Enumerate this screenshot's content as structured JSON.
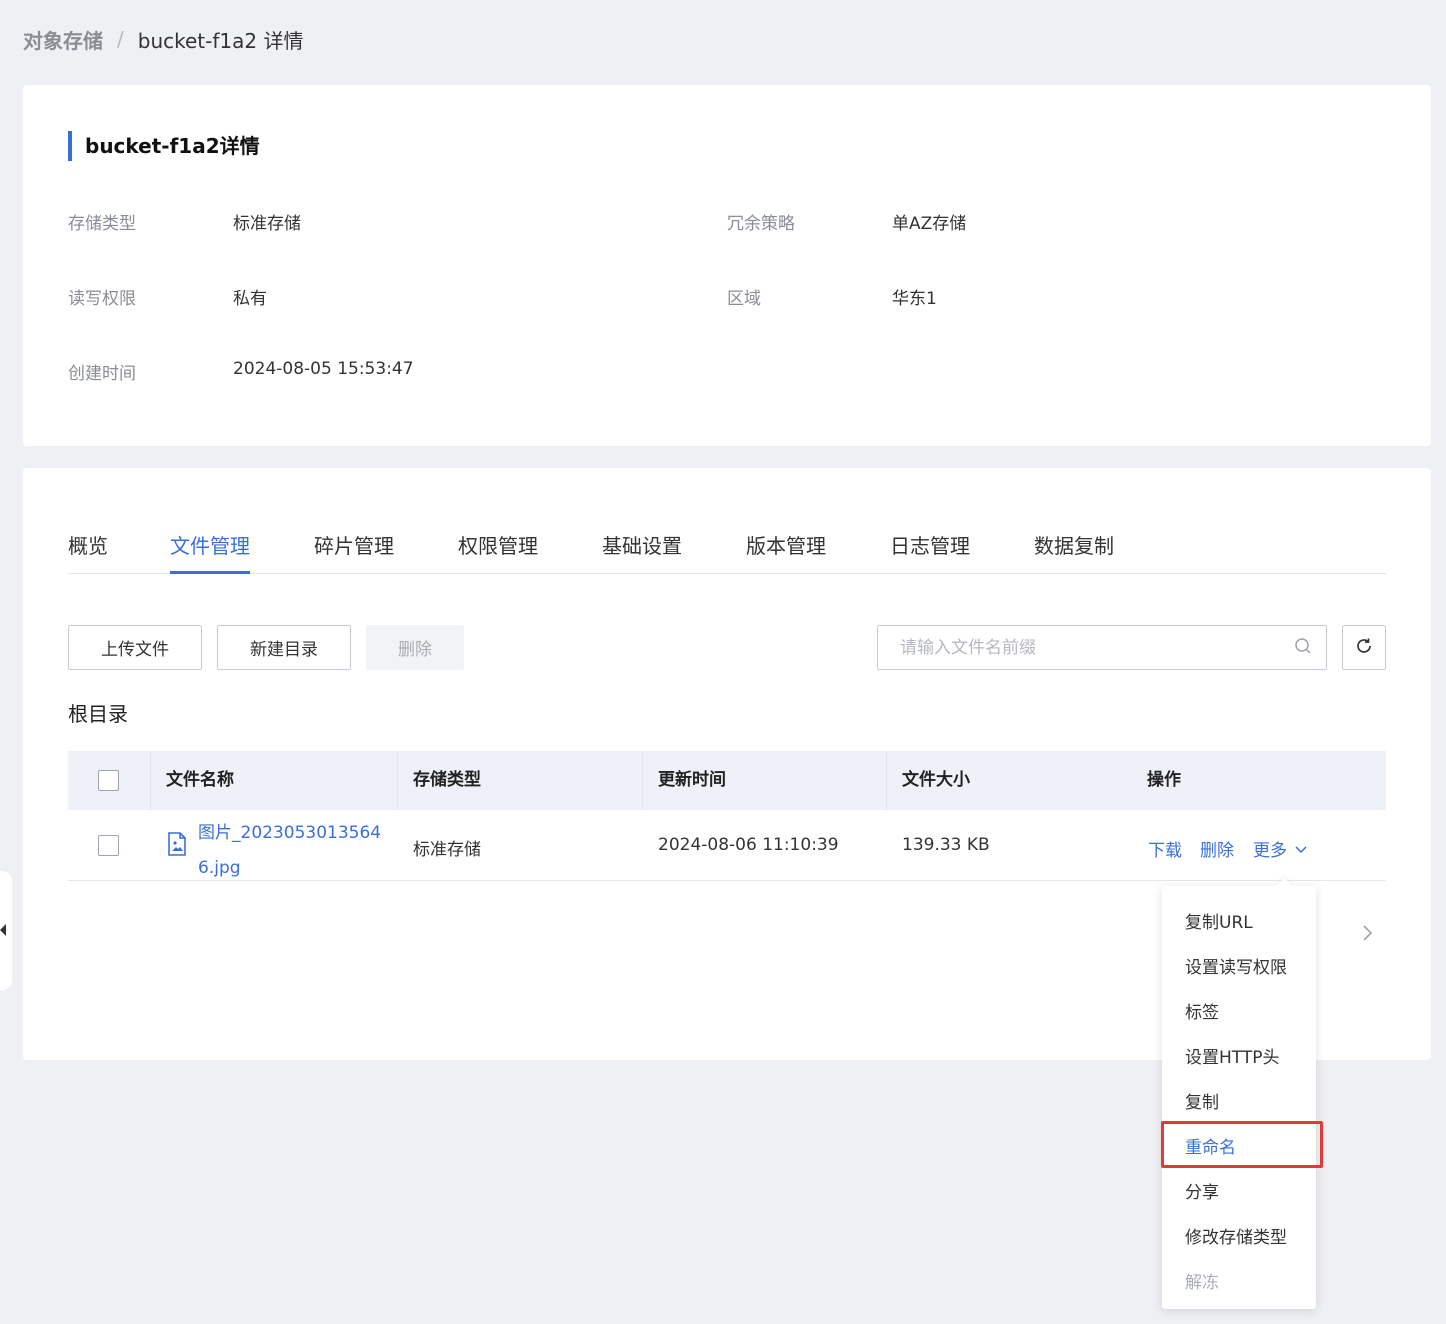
{
  "breadcrumb": {
    "root": "对象存储",
    "separator": "/",
    "current": "bucket-f1a2 详情"
  },
  "info": {
    "title": "bucket-f1a2详情",
    "fields": {
      "storage_type": {
        "label": "存储类型",
        "value": "标准存储"
      },
      "redundancy": {
        "label": "冗余策略",
        "value": "单AZ存储"
      },
      "permission": {
        "label": "读写权限",
        "value": "私有"
      },
      "region": {
        "label": "区域",
        "value": "华东1"
      },
      "created": {
        "label": "创建时间",
        "value": "2024-08-05 15:53:47"
      }
    }
  },
  "tabs": [
    "概览",
    "文件管理",
    "碎片管理",
    "权限管理",
    "基础设置",
    "版本管理",
    "日志管理",
    "数据复制"
  ],
  "active_tab": "文件管理",
  "toolbar": {
    "upload": "上传文件",
    "new_dir": "新建目录",
    "delete": "删除"
  },
  "search": {
    "placeholder": "请输入文件名前缀",
    "value": ""
  },
  "directory": "根目录",
  "table": {
    "headers": {
      "name": "文件名称",
      "storage_type": "存储类型",
      "updated": "更新时间",
      "size": "文件大小",
      "actions": "操作"
    },
    "rows": [
      {
        "name": "图片_20230530135646.jpg",
        "storage_type": "标准存储",
        "updated": "2024-08-06 11:10:39",
        "size": "139.33 KB",
        "actions": {
          "download": "下载",
          "delete": "删除",
          "more": "更多"
        }
      }
    ]
  },
  "more_menu": {
    "items": [
      "复制URL",
      "设置读写权限",
      "标签",
      "设置HTTP头",
      "复制",
      "重命名",
      "分享",
      "修改存储类型",
      "解冻"
    ],
    "highlighted": "重命名",
    "disabled": [
      "解冻"
    ]
  },
  "colors": {
    "accent": "#3a6fd8",
    "highlight_box": "#e53935",
    "background": "#eff0f4"
  },
  "icons": {
    "search": "search-icon",
    "refresh": "refresh-icon",
    "file": "image-file-icon",
    "more": "chevron-down-icon",
    "next": "chevron-right-icon"
  }
}
